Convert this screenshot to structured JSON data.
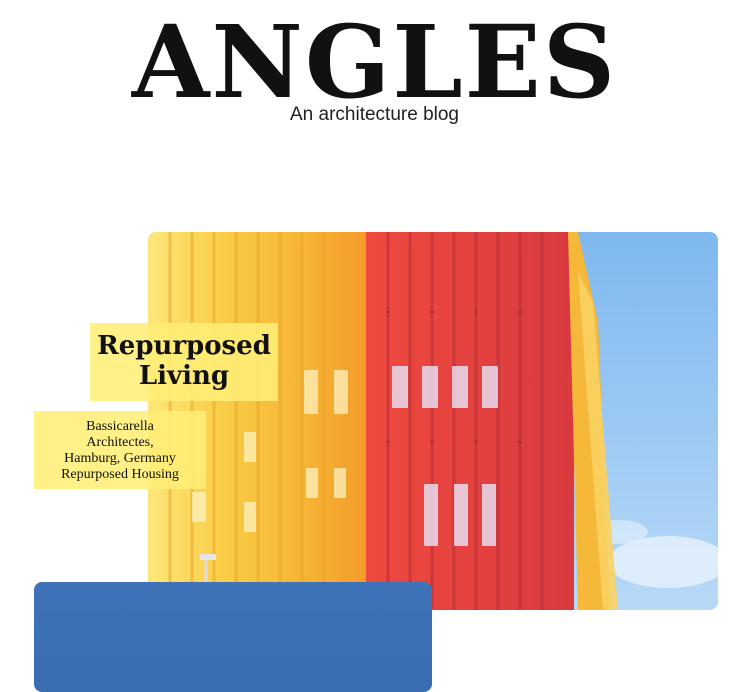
{
  "site": {
    "title": "ANGLES",
    "subtitle": "An architecture blog"
  },
  "featured_post": {
    "title": "Repurposed Living",
    "meta": [
      "Bassicarella",
      "Architectes,",
      "Hamburg, Germany",
      "Repurposed Housing"
    ],
    "image": {
      "description_icon": "building-facade-image",
      "colors": {
        "yellow": "#f8c63a",
        "orange": "#f39a2a",
        "red": "#e8403e",
        "sky": "#8ec3f1"
      }
    }
  },
  "second_post": {
    "image": {
      "description_icon": "sky-image",
      "color": "#3f72b7"
    }
  }
}
